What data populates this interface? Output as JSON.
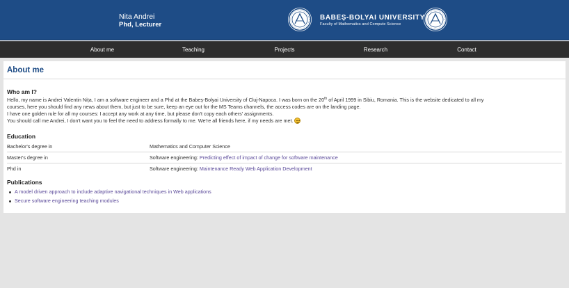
{
  "header": {
    "name": "Nita Andrei",
    "role": "Phd, Lecturer",
    "university": "BABEȘ-BOLYAI UNIVERSITY",
    "faculty": "Faculty of Mathematics and Compute Science",
    "seal_text": "UBB"
  },
  "nav": {
    "items": [
      {
        "label": "About me"
      },
      {
        "label": "Teaching"
      },
      {
        "label": "Projects"
      },
      {
        "label": "Research"
      },
      {
        "label": "Contact"
      }
    ]
  },
  "main": {
    "title": "About me",
    "who": {
      "heading": "Who am I?",
      "line1_a": "Hello, my name is Andrei Valentin Nița, I am a software engineer and a Phd at the Babeș-Bolyai University of Cluj-Napoca. I was born on the 20",
      "line1_sup": "th",
      "line1_b": " of April 1999 in Sibiu, Romania. This is the website dedicated to all my",
      "line2": "courses, here you should find any news about them, but just to be sure, keep an eye out for the MS Teams channels, the access codes are on the landing page.",
      "line3": "I have one golden rule for all my courses: I accept any work at any time, but please don't copy each others' assignments.",
      "line4": "You should call me Andrei, I don't want you to feel the need to address formally to me. We're all friends here, if my needs are met."
    },
    "education": {
      "heading": "Education",
      "rows": [
        {
          "label": "Bachelor's degree in",
          "field": "Mathematics and Computer Science",
          "link": ""
        },
        {
          "label": "Master's degree in",
          "field": "Software engineering: ",
          "link": "Predicting effect of impact of change for software maintenance"
        },
        {
          "label": "Phd in",
          "field": "Software engineering: ",
          "link": "Maintenance Ready Web Application Development"
        }
      ]
    },
    "publications": {
      "heading": "Publications",
      "items": [
        "A model driven approach to include adaptive navigational techniques in Web applications",
        "Secure software engineering teaching modules"
      ]
    }
  },
  "colors": {
    "header_bg": "#1e4c86",
    "nav_bg": "#2e2e2e",
    "title_color": "#1e4c86",
    "link_color": "#5b4a9a",
    "page_bg": "#e4e4e4"
  }
}
